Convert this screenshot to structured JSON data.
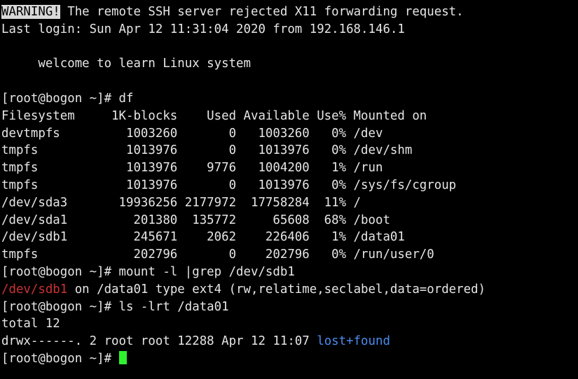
{
  "terminal": {
    "title": "root@bogon:~",
    "colors": {
      "background": "#000000",
      "foreground": "#e6e6e6",
      "inverse_bg": "#d9d9d9",
      "inverse_fg": "#000000",
      "red": "#cc3232",
      "blue": "#4a8cf0",
      "cursor_green": "#2ff22f"
    },
    "prompt": "[root@bogon ~]# ",
    "lines": [
      {
        "id": "warning-line",
        "segments": [
          {
            "text": "WARNING!",
            "style": "inverse"
          },
          {
            "text": " The remote SSH server rejected X11 forwarding request.",
            "style": "normal"
          }
        ]
      },
      {
        "id": "last-login-line",
        "segments": [
          {
            "text": "Last login: Sun Apr 12 11:31:04 2020 from 192.168.146.1",
            "style": "normal"
          }
        ]
      },
      {
        "id": "blank-1",
        "segments": [
          {
            "text": "",
            "style": "normal"
          }
        ]
      },
      {
        "id": "motd-welcome-line",
        "segments": [
          {
            "text": "     welcome to learn Linux system",
            "style": "normal"
          }
        ]
      },
      {
        "id": "blank-2",
        "segments": [
          {
            "text": "",
            "style": "normal"
          }
        ]
      },
      {
        "id": "prompt-df",
        "segments": [
          {
            "text": "[root@bogon ~]# df",
            "style": "normal"
          }
        ]
      },
      {
        "id": "df-header",
        "segments": [
          {
            "text": "Filesystem     1K-blocks    Used Available Use% Mounted on",
            "style": "normal"
          }
        ]
      },
      {
        "id": "df-row-devtmpfs",
        "segments": [
          {
            "text": "devtmpfs         1003260       0   1003260   0% /dev",
            "style": "normal"
          }
        ]
      },
      {
        "id": "df-row-tmpfs-shm",
        "segments": [
          {
            "text": "tmpfs            1013976       0   1013976   0% /dev/shm",
            "style": "normal"
          }
        ]
      },
      {
        "id": "df-row-tmpfs-run",
        "segments": [
          {
            "text": "tmpfs            1013976    9776   1004200   1% /run",
            "style": "normal"
          }
        ]
      },
      {
        "id": "df-row-tmpfs-cgroup",
        "segments": [
          {
            "text": "tmpfs            1013976       0   1013976   0% /sys/fs/cgroup",
            "style": "normal"
          }
        ]
      },
      {
        "id": "df-row-sda3",
        "segments": [
          {
            "text": "/dev/sda3       19936256 2177972  17758284  11% /",
            "style": "normal"
          }
        ]
      },
      {
        "id": "df-row-sda1",
        "segments": [
          {
            "text": "/dev/sda1         201380  135772     65608  68% /boot",
            "style": "normal"
          }
        ]
      },
      {
        "id": "df-row-sdb1",
        "segments": [
          {
            "text": "/dev/sdb1         245671    2062    226406   1% /data01",
            "style": "normal"
          }
        ]
      },
      {
        "id": "df-row-tmpfs-user0",
        "segments": [
          {
            "text": "tmpfs             202796       0    202796   0% /run/user/0",
            "style": "normal"
          }
        ]
      },
      {
        "id": "prompt-mount",
        "segments": [
          {
            "text": "[root@bogon ~]# mount -l |grep /dev/sdb1",
            "style": "normal"
          }
        ]
      },
      {
        "id": "mount-output-sdb1",
        "segments": [
          {
            "text": "/dev/sdb1",
            "style": "red"
          },
          {
            "text": " on /data01 type ext4 (rw,relatime,seclabel,data=ordered)",
            "style": "normal"
          }
        ]
      },
      {
        "id": "prompt-ls",
        "segments": [
          {
            "text": "[root@bogon ~]# ls -lrt /data01",
            "style": "normal"
          }
        ]
      },
      {
        "id": "ls-total-line",
        "segments": [
          {
            "text": "total 12",
            "style": "normal"
          }
        ]
      },
      {
        "id": "ls-row-lost-found",
        "segments": [
          {
            "text": "drwx------. 2 root root 12288 Apr 12 11:07 ",
            "style": "normal"
          },
          {
            "text": "lost+found",
            "style": "blue"
          }
        ]
      },
      {
        "id": "prompt-active",
        "segments": [
          {
            "text": "[root@bogon ~]# ",
            "style": "normal"
          },
          {
            "text": " ",
            "style": "cursor"
          }
        ]
      }
    ]
  },
  "df_table": {
    "command": "df",
    "columns": [
      "Filesystem",
      "1K-blocks",
      "Used",
      "Available",
      "Use%",
      "Mounted on"
    ],
    "rows": [
      {
        "filesystem": "devtmpfs",
        "blocks": "1003260",
        "used": "0",
        "available": "1003260",
        "use_pct": "0%",
        "mounted_on": "/dev"
      },
      {
        "filesystem": "tmpfs",
        "blocks": "1013976",
        "used": "0",
        "available": "1013976",
        "use_pct": "0%",
        "mounted_on": "/dev/shm"
      },
      {
        "filesystem": "tmpfs",
        "blocks": "1013976",
        "used": "9776",
        "available": "1004200",
        "use_pct": "1%",
        "mounted_on": "/run"
      },
      {
        "filesystem": "tmpfs",
        "blocks": "1013976",
        "used": "0",
        "available": "1013976",
        "use_pct": "0%",
        "mounted_on": "/sys/fs/cgroup"
      },
      {
        "filesystem": "/dev/sda3",
        "blocks": "19936256",
        "used": "2177972",
        "available": "17758284",
        "use_pct": "11%",
        "mounted_on": "/"
      },
      {
        "filesystem": "/dev/sda1",
        "blocks": "201380",
        "used": "135772",
        "available": "65608",
        "use_pct": "68%",
        "mounted_on": "/boot"
      },
      {
        "filesystem": "/dev/sdb1",
        "blocks": "245671",
        "used": "2062",
        "available": "226406",
        "use_pct": "1%",
        "mounted_on": "/data01"
      },
      {
        "filesystem": "tmpfs",
        "blocks": "202796",
        "used": "0",
        "available": "202796",
        "use_pct": "0%",
        "mounted_on": "/run/user/0"
      }
    ]
  },
  "ls_listing": {
    "command": "ls -lrt /data01",
    "total": "total 12",
    "entries": [
      {
        "permissions": "drwx------.",
        "links": "2",
        "owner": "root",
        "group": "root",
        "size": "12288",
        "month": "Apr",
        "day": "12",
        "time": "11:07",
        "name": "lost+found",
        "type": "directory"
      }
    ]
  },
  "mount_info": {
    "command": "mount -l |grep /dev/sdb1",
    "device": "/dev/sdb1",
    "mount_point": "/data01",
    "fs_type": "ext4",
    "options": "rw,relatime,seclabel,data=ordered"
  }
}
